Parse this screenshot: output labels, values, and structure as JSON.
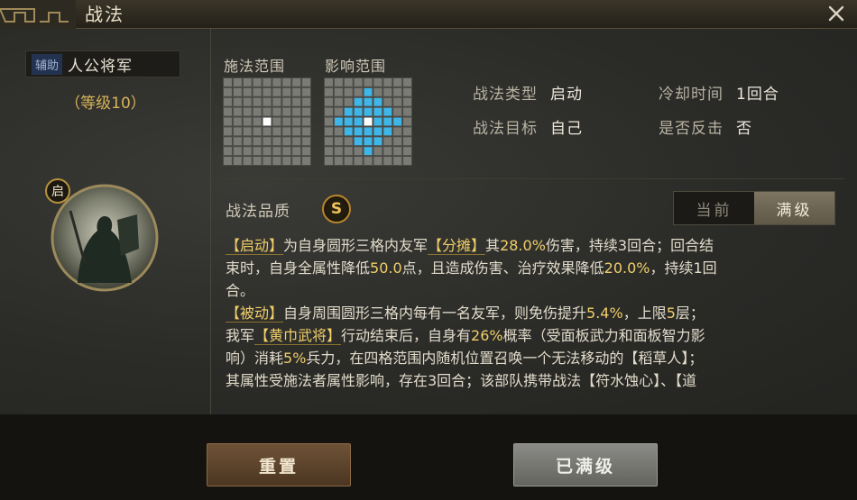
{
  "window": {
    "title": "战法"
  },
  "general": {
    "role": "辅助",
    "name": "人公将军",
    "level": "（等级10）",
    "skill_type_badge": "启"
  },
  "ranges": {
    "cast_label": "施法范围",
    "effect_label": "影响范围"
  },
  "info": {
    "type_key": "战法类型",
    "type_val": "启动",
    "cooldown_key": "冷却时间",
    "cooldown_val": "1回合",
    "target_key": "战法目标",
    "target_val": "自己",
    "counter_key": "是否反击",
    "counter_val": "否"
  },
  "quality": {
    "label": "战法品质",
    "grade": "S"
  },
  "toggle": {
    "current": "当前",
    "max": "满级",
    "selected": "max"
  },
  "description": {
    "l1_a": "【启动】",
    "l1_b": "为自身圆形三格内友军",
    "l1_c": "【分摊】",
    "l1_d": "其",
    "l1_e": "28.0%",
    "l1_f": "伤害，持续3回合；回合结",
    "l2_a": "束时，自身全属性降低",
    "l2_b": "50.0",
    "l2_c": "点，且造成伤害、治疗效果降低",
    "l2_d": "20.0%",
    "l2_e": "，持续1回",
    "l3_a": "合。",
    "l4_a": "【被动】",
    "l4_b": "自身周围圆形三格内每有一名友军，则免伤提升",
    "l4_c": "5.4%",
    "l4_d": "，上限",
    "l4_e": "5",
    "l4_f": "层；",
    "l5_a": "我军",
    "l5_b": "【黄巾武将】",
    "l5_c": "行动结束后，自身有",
    "l5_d": "26%",
    "l5_e": "概率（受面板武力和面板智力影",
    "l6_a": "响）消耗",
    "l6_b": "5%",
    "l6_c": "兵力，在四格范围内随机位置召唤一个无法移动的【稻草人】；",
    "l7_a": "其属性受施法者属性影响，存在3回合；该部队携带战法【符水蚀心】、【道"
  },
  "buttons": {
    "reset": "重置",
    "maxed": "已满级"
  },
  "colors": {
    "accent_gold": "#f0cf6a",
    "range_cyan": "#3fb6e8",
    "button_brown": "#6e5236"
  }
}
